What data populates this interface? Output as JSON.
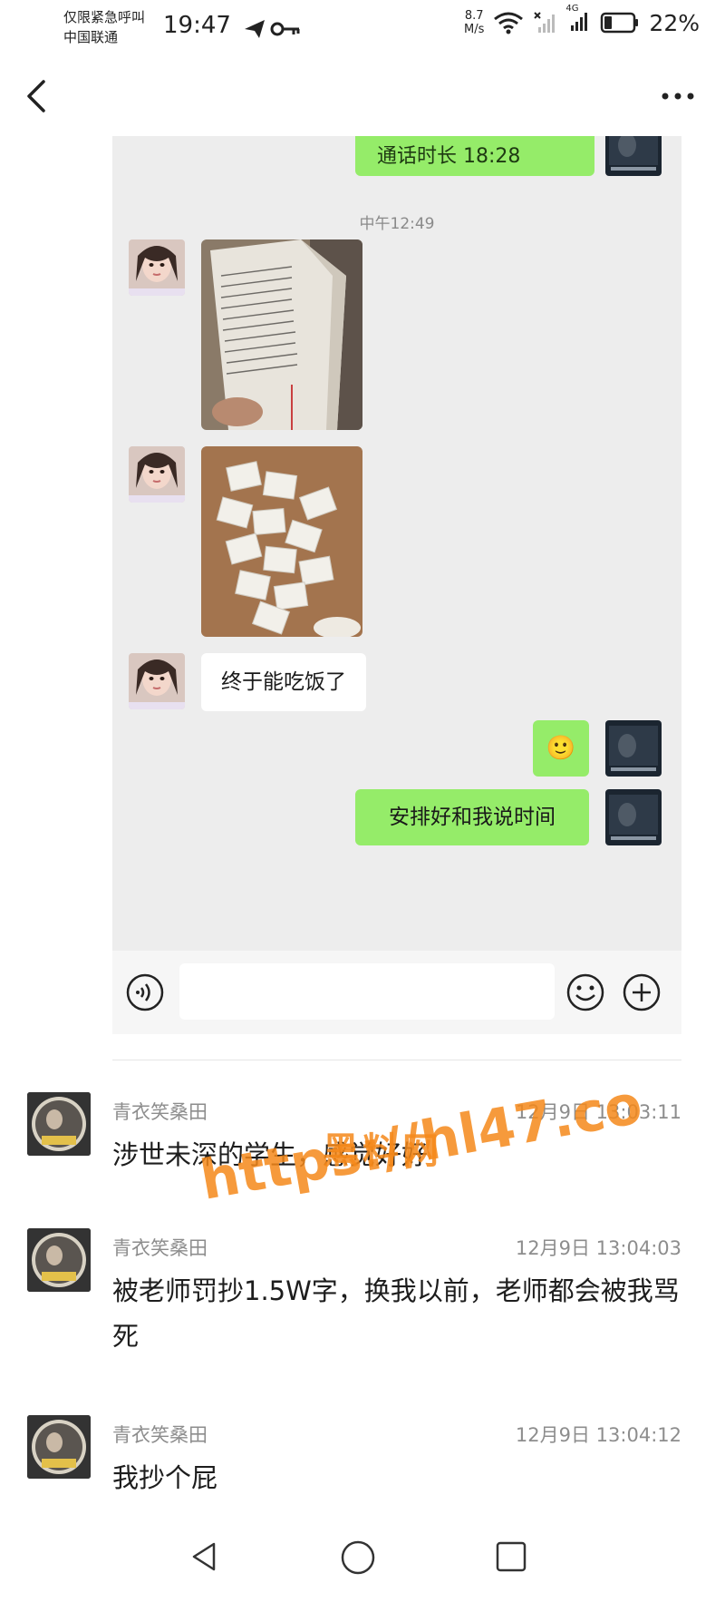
{
  "status_bar": {
    "carrier_line1": "仅限紧急呼叫",
    "carrier_line2": "中国联通",
    "time": "19:47",
    "net_speed_value": "8.7",
    "net_speed_unit": "M/s",
    "network_type": "4G",
    "battery": "22%"
  },
  "chat": {
    "call_text": "通话时长 18:28",
    "time_separator": "中午12:49",
    "message_text": "终于能吃饭了",
    "reply_emoji": "🙂",
    "reply_text": "安排好和我说时间"
  },
  "comments": [
    {
      "name": "青衣笑桑田",
      "time": "12月9日 13:03:11",
      "text": "涉世未深的学生，感觉好好"
    },
    {
      "name": "青衣笑桑田",
      "time": "12月9日 13:04:03",
      "text": "被老师罚抄1.5W字，换我以前，老师都会被我骂死"
    },
    {
      "name": "青衣笑桑田",
      "time": "12月9日 13:04:12",
      "text": "我抄个屁"
    }
  ],
  "watermark": {
    "brand": "黑料网",
    "url": "https://hl47.co"
  },
  "colors": {
    "bubble_green": "#95ec69",
    "chat_bg": "#ededed",
    "watermark": "#f4881a"
  }
}
